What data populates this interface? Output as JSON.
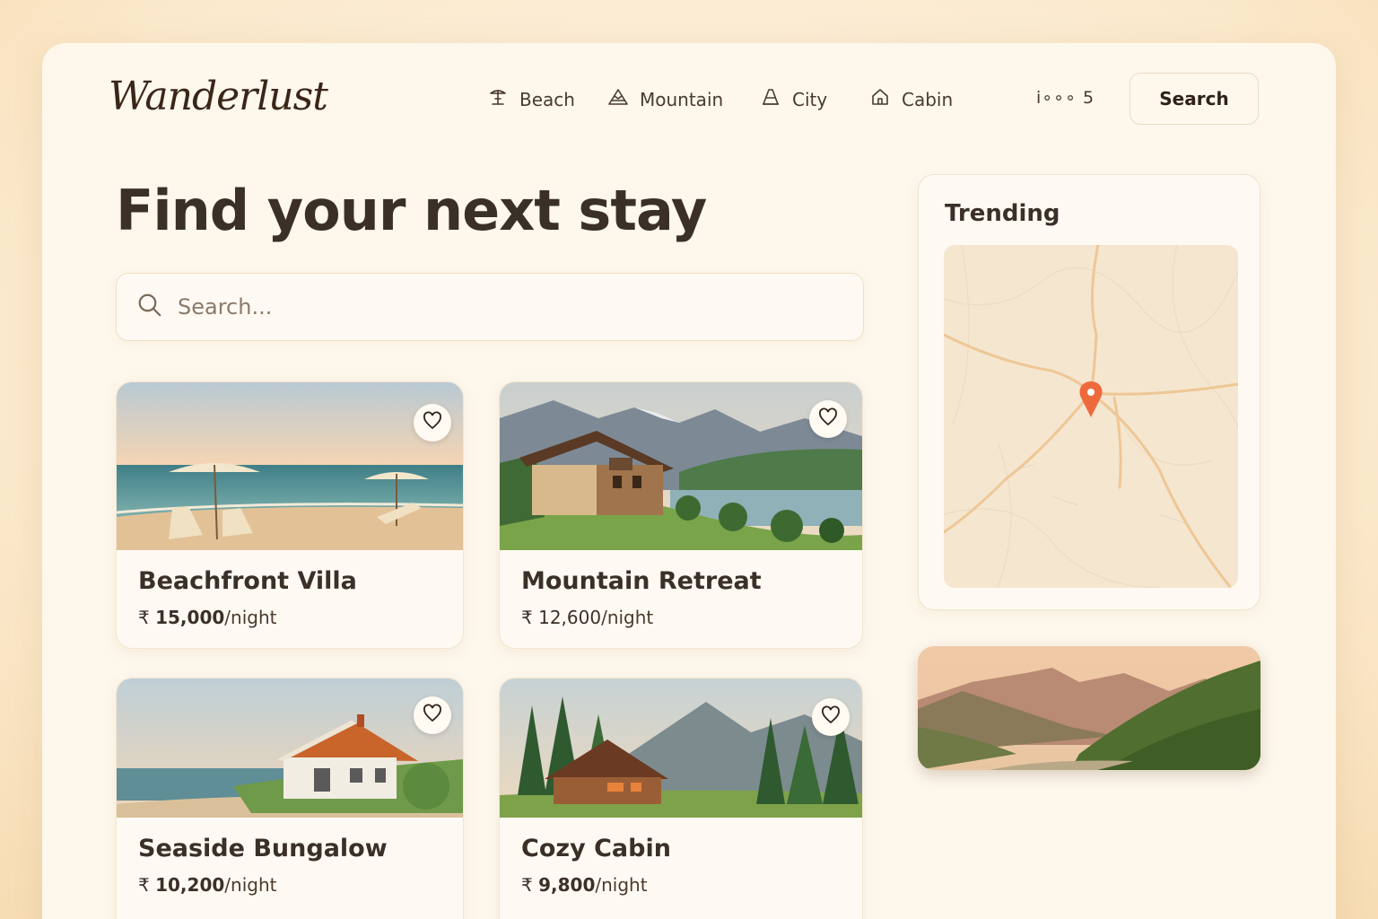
{
  "header": {
    "logo": "Wanderlust",
    "nav": [
      {
        "label": "Beach",
        "icon": "beach-umbrella-icon"
      },
      {
        "label": "Mountain",
        "icon": "mountain-icon"
      },
      {
        "label": "City",
        "icon": "city-icon"
      },
      {
        "label": "Cabin",
        "icon": "cabin-icon"
      }
    ],
    "counter": "i∘∘∘ 5",
    "search_button": "Search"
  },
  "hero": {
    "title": "Find your next stay",
    "search_placeholder": "Search..."
  },
  "listings": [
    {
      "name": "Beachfront Villa",
      "currency": "₹",
      "price": "15,000",
      "unit": "/night"
    },
    {
      "name": "Mountain Retreat",
      "currency": "₹",
      "price": "12,600",
      "unit": "/night"
    },
    {
      "name": "Seaside Bungalow",
      "currency": "₹",
      "price": "10,200",
      "unit": "/night"
    },
    {
      "name": "Cozy Cabin",
      "currency": "₹",
      "price": "9,800",
      "unit": "/night"
    }
  ],
  "trending": {
    "title": "Trending"
  },
  "colors": {
    "accent": "#ee6a3c",
    "text": "#3a3028",
    "background": "#fdf7ec"
  }
}
